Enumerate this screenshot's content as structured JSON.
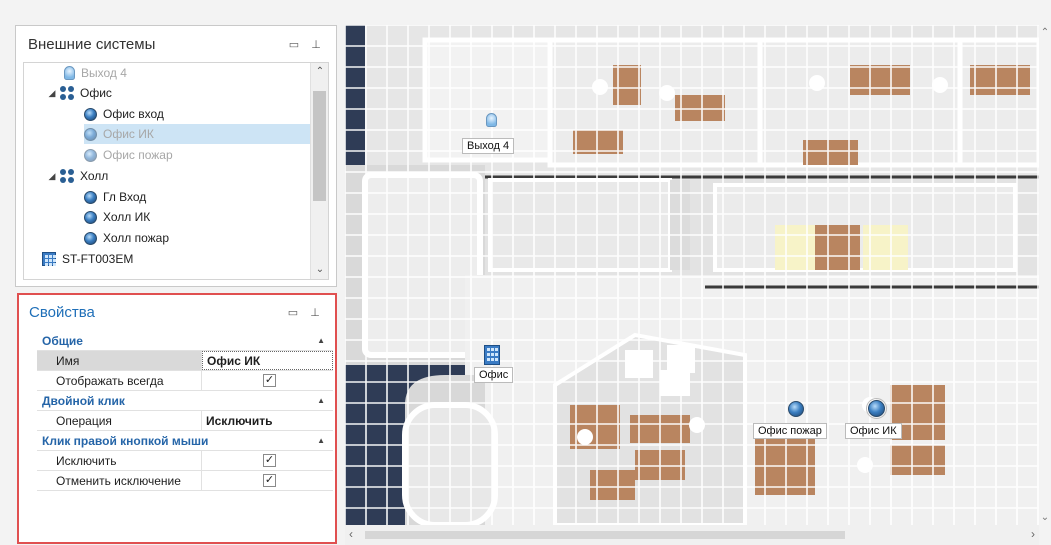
{
  "external_systems": {
    "title": "Внешние системы",
    "tree": [
      {
        "label": "Выход  4",
        "icon": "bulb-icon",
        "level": 1,
        "dim": true
      },
      {
        "label": "Офис",
        "icon": "group-icon",
        "level": 0,
        "expanded": true
      },
      {
        "label": "Офис вход",
        "icon": "zone-icon",
        "level": 1
      },
      {
        "label": "Офис ИК",
        "icon": "zone-icon",
        "level": 1,
        "selected": true,
        "dim": true
      },
      {
        "label": "Офис пожар",
        "icon": "zone-icon",
        "level": 1,
        "dim": true
      },
      {
        "label": "Холл",
        "icon": "group-icon",
        "level": 0,
        "expanded": true
      },
      {
        "label": "Гл Вход",
        "icon": "zone-icon",
        "level": 1
      },
      {
        "label": "Холл ИК",
        "icon": "zone-icon",
        "level": 1
      },
      {
        "label": "Холл пожар",
        "icon": "zone-icon",
        "level": 1
      },
      {
        "label": "ST-FT003EM",
        "icon": "device-icon",
        "level": -1
      }
    ]
  },
  "properties": {
    "title": "Свойства",
    "sections": [
      {
        "name": "Общие",
        "rows": [
          {
            "name": "Имя",
            "value": "Офис ИК",
            "selected": true
          },
          {
            "name": "Отображать всегда",
            "checkbox": true
          }
        ]
      },
      {
        "name": "Двойной клик",
        "rows": [
          {
            "name": "Операция",
            "value": "Исключить"
          }
        ]
      },
      {
        "name": "Клик правой кнопкой мыши",
        "rows": [
          {
            "name": "Исключить",
            "checkbox": true
          },
          {
            "name": "Отменить исключение",
            "checkbox": true
          }
        ]
      }
    ]
  },
  "map": {
    "labels": {
      "exit": "Выход  4",
      "office": "Офис",
      "office_fire": "Офис пожар",
      "office_ir": "Офис ИК"
    }
  },
  "colors": {
    "accent": "#1f6fb8",
    "highlight_border": "#e05050",
    "selection": "#cde4f5",
    "floor": "#e9e9e9",
    "wall": "#ffffff",
    "furniture": "#b98560",
    "background": "#2f3c56"
  }
}
